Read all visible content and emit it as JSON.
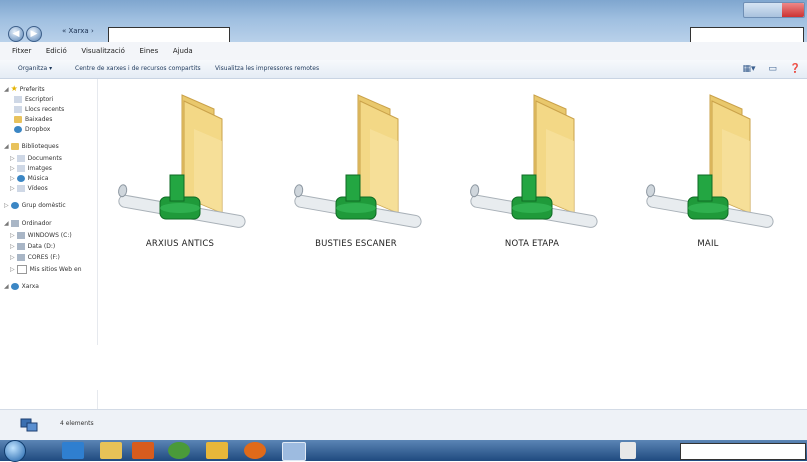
{
  "window": {
    "address_prefix": "« Xarxa ›",
    "nav_back": "◀",
    "nav_forward": "▶"
  },
  "menu": [
    "Fitxer",
    "Edició",
    "Visualització",
    "Eines",
    "Ajuda"
  ],
  "toolbar": {
    "organize": "Organitza ▾",
    "network_center": "Centre de xarxes i de recursos compartits",
    "view_remote": "Visualitza les impressores remotes"
  },
  "nav": {
    "favorites": {
      "label": "Preferits",
      "items": [
        "Escriptori",
        "Llocs recents",
        "Baixades",
        "Dropbox"
      ]
    },
    "libraries": {
      "label": "Biblioteques",
      "items": [
        "Documents",
        "Imatges",
        "Música",
        "Vídeos"
      ]
    },
    "homegroup": "Grup domèstic",
    "computer": {
      "label": "Ordinador",
      "items": [
        "WINDOWS (C:)",
        "Data (D:)",
        "CORES (F:)",
        "Mis sitios Web en"
      ]
    },
    "network": "Xarxa"
  },
  "shares": [
    {
      "label": "ARXIUS ANTICS"
    },
    {
      "label": "BUSTIES ESCANER"
    },
    {
      "label": "NOTA ETAPA"
    },
    {
      "label": "MAIL"
    }
  ],
  "status": {
    "count": "4 elements"
  },
  "colors": {
    "folder": "#f2d27a",
    "folder_dark": "#d9b04e",
    "pipe_green": "#1f9a3a",
    "taskbar": "#2a5a94"
  }
}
